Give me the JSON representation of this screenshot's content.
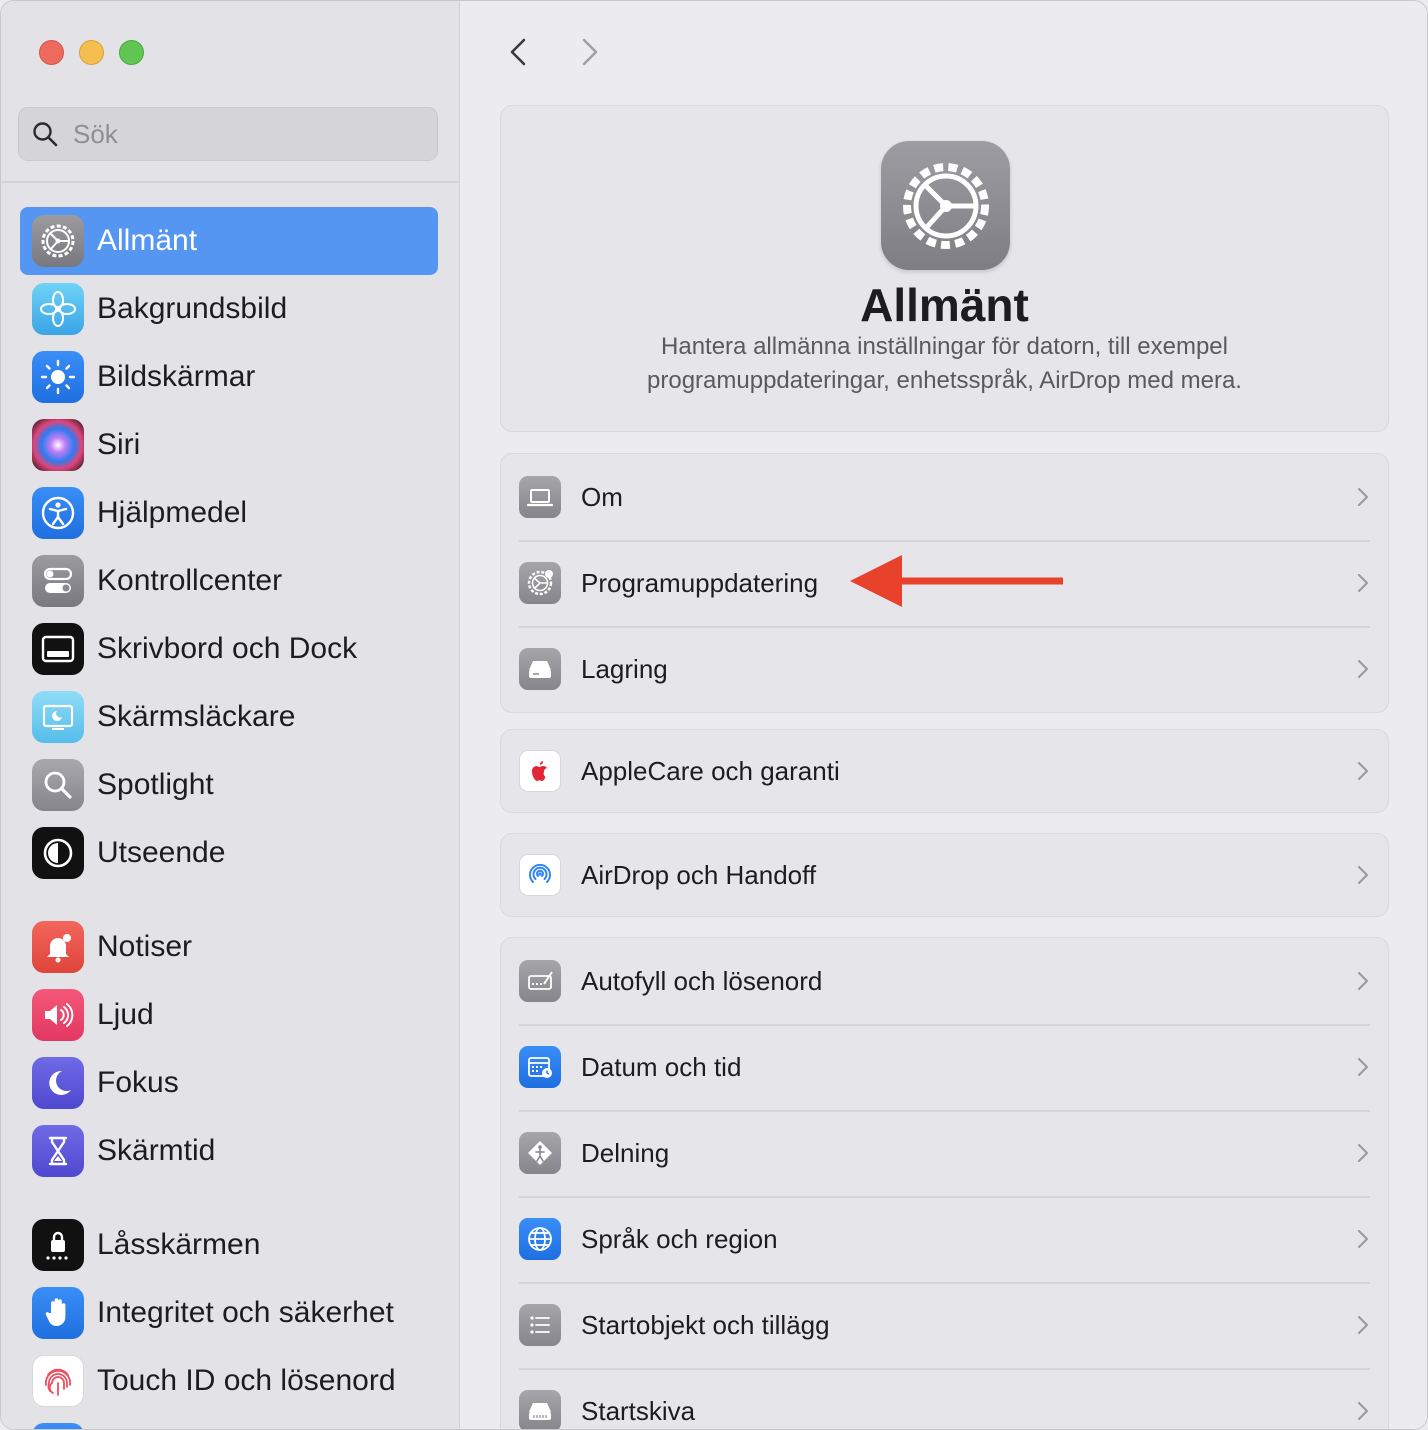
{
  "window": {
    "traffic_lights": [
      "close",
      "minimize",
      "zoom"
    ],
    "colors": {
      "close": "#ed6a5e",
      "minimize": "#f5bf4f",
      "zoom": "#61c554",
      "accent": "#5596f3",
      "arrow": "#e8412c"
    }
  },
  "sidebar": {
    "search": {
      "placeholder": "Sök",
      "value": ""
    },
    "selected": "Allmänt",
    "groups": [
      [
        {
          "label": "Allmänt",
          "icon": "gear-icon"
        },
        {
          "label": "Bakgrundsbild",
          "icon": "flower-icon"
        },
        {
          "label": "Bildskärmar",
          "icon": "sun-icon"
        },
        {
          "label": "Siri",
          "icon": "siri-icon"
        },
        {
          "label": "Hjälpmedel",
          "icon": "accessibility-icon"
        },
        {
          "label": "Kontrollcenter",
          "icon": "toggles-icon"
        },
        {
          "label": "Skrivbord och Dock",
          "icon": "dock-icon"
        },
        {
          "label": "Skärmsläckare",
          "icon": "screensaver-icon"
        },
        {
          "label": "Spotlight",
          "icon": "magnifier-icon"
        },
        {
          "label": "Utseende",
          "icon": "appearance-icon"
        }
      ],
      [
        {
          "label": "Notiser",
          "icon": "bell-icon"
        },
        {
          "label": "Ljud",
          "icon": "speaker-icon"
        },
        {
          "label": "Fokus",
          "icon": "moon-icon"
        },
        {
          "label": "Skärmtid",
          "icon": "hourglass-icon"
        }
      ],
      [
        {
          "label": "Låsskärmen",
          "icon": "lock-icon"
        },
        {
          "label": "Integritet och säkerhet",
          "icon": "hand-icon"
        },
        {
          "label": "Touch ID och lösenord",
          "icon": "fingerprint-icon"
        }
      ]
    ]
  },
  "main": {
    "nav": {
      "back": "chevron-left-icon",
      "forward": "chevron-right-icon"
    },
    "hero": {
      "title": "Allmänt",
      "description": "Hantera allmänna inställningar för datorn, till exempel programuppdateringar, enhetsspråk, AirDrop med mera."
    },
    "groups": [
      [
        {
          "label": "Om",
          "icon": "laptop-icon"
        },
        {
          "label": "Programuppdatering",
          "icon": "gear-badge-icon"
        },
        {
          "label": "Lagring",
          "icon": "drive-icon"
        }
      ],
      [
        {
          "label": "AppleCare och garanti",
          "icon": "apple-icon"
        }
      ],
      [
        {
          "label": "AirDrop och Handoff",
          "icon": "airdrop-icon"
        }
      ],
      [
        {
          "label": "Autofyll och lösenord",
          "icon": "keyboard-pen-icon"
        },
        {
          "label": "Datum och tid",
          "icon": "calendar-clock-icon"
        },
        {
          "label": "Delning",
          "icon": "sharing-icon"
        },
        {
          "label": "Språk och region",
          "icon": "globe-icon"
        },
        {
          "label": "Startobjekt och tillägg",
          "icon": "list-icon"
        },
        {
          "label": "Startskiva",
          "icon": "startup-disk-icon"
        }
      ]
    ],
    "annotation": {
      "type": "arrow",
      "points_to": "Programuppdatering"
    }
  }
}
